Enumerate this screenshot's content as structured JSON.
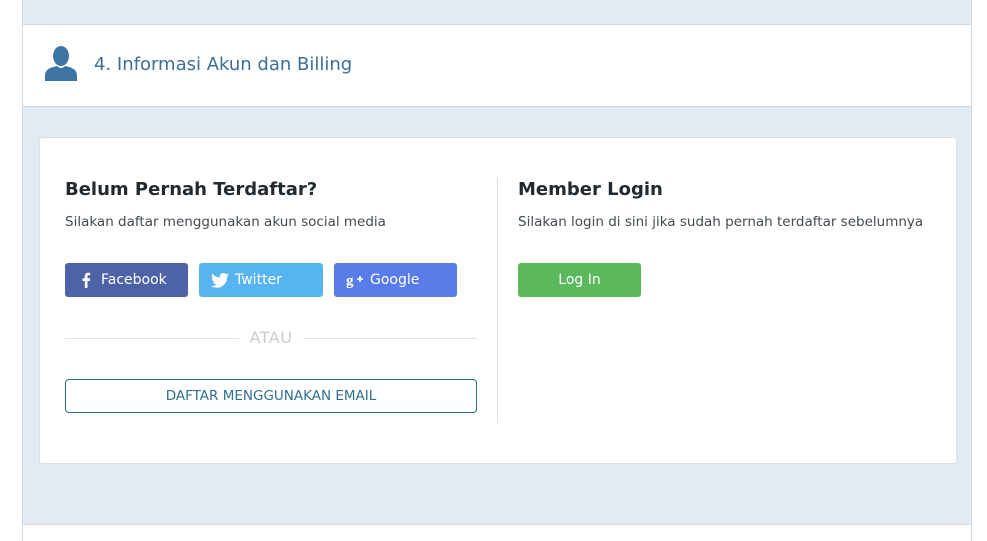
{
  "section": {
    "title": "4. Informasi Akun dan Billing",
    "icon": "user-icon"
  },
  "register": {
    "heading": "Belum Pernah Terdaftar?",
    "subtext": "Silakan daftar menggunakan akun social media",
    "social_buttons": [
      {
        "label": "Facebook",
        "icon": "facebook-icon",
        "color": "#4e62a6"
      },
      {
        "label": "Twitter",
        "icon": "twitter-icon",
        "color": "#56b4f1"
      },
      {
        "label": "Google",
        "icon": "google-plus-icon",
        "color": "#5a7ce8"
      }
    ],
    "or_text": "ATAU",
    "email_button_label": "DAFTAR MENGGUNAKAN EMAIL"
  },
  "login": {
    "heading": "Member Login",
    "subtext": "Silakan login di sini jika sudah pernah terdaftar sebelumnya",
    "button_label": "Log In",
    "button_color": "#5cb85c"
  },
  "colors": {
    "accent": "#3b6e99",
    "background": "#e3ebf2"
  }
}
